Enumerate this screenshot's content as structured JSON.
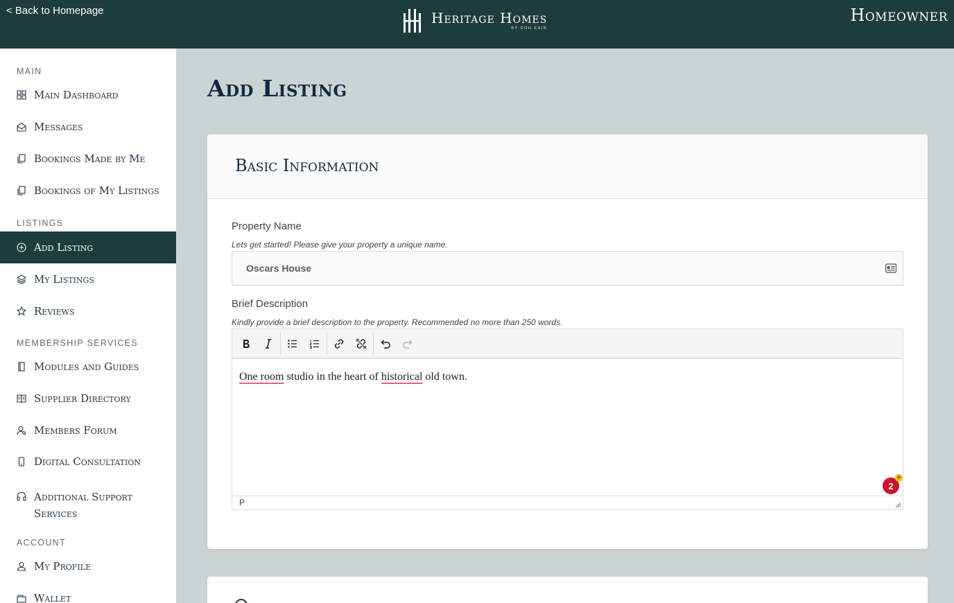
{
  "header": {
    "back_link": "< Back to Homepage",
    "brand_name": "Heritage Homes",
    "brand_sub": "BY DOH EAIN",
    "role": "Homeowner"
  },
  "sidebar": {
    "sections": [
      {
        "label": "MAIN",
        "items": [
          {
            "label": "Main Dashboard",
            "icon": "dashboard-grid-icon"
          },
          {
            "label": "Messages",
            "icon": "envelope-open-icon"
          },
          {
            "label": "Bookings Made by Me",
            "icon": "documents-icon"
          },
          {
            "label": "Bookings of My Listings",
            "icon": "documents-icon"
          }
        ]
      },
      {
        "label": "LISTINGS",
        "items": [
          {
            "label": "Add Listing",
            "icon": "plus-circle-icon",
            "active": true
          },
          {
            "label": "My Listings",
            "icon": "layers-icon"
          },
          {
            "label": "Reviews",
            "icon": "star-icon"
          }
        ]
      },
      {
        "label": "MEMBERSHIP SERVICES",
        "items": [
          {
            "label": "Modules and Guides",
            "icon": "book-icon"
          },
          {
            "label": "Supplier Directory",
            "icon": "open-book-icon"
          },
          {
            "label": "Members Forum",
            "icon": "user-search-icon"
          },
          {
            "label": "Digital Consultation",
            "icon": "phone-icon"
          },
          {
            "label": "Additional Support Services",
            "icon": "headphones-icon"
          }
        ]
      },
      {
        "label": "ACCOUNT",
        "items": [
          {
            "label": "My Profile",
            "icon": "user-icon"
          },
          {
            "label": "Wallet",
            "icon": "wallet-icon"
          }
        ]
      }
    ]
  },
  "main": {
    "page_title": "Add Listing",
    "basic_info": {
      "title": "Basic Information",
      "property_name": {
        "label": "Property Name",
        "hint": "Lets get started! Please give your property a unique name.",
        "value": "Oscars House"
      },
      "brief_description": {
        "label": "Brief Description",
        "hint": "Kindly provide a brief description to the property. Recommended no more than 250 words.",
        "content_parts": [
          "One room",
          " studio in the heart of ",
          "historical",
          " old town."
        ],
        "status_path": "P",
        "badge_count": "2",
        "badge_plus": "+"
      }
    }
  },
  "colors": {
    "header_bg": "#1c3c3e",
    "page_bg": "#c9d4d3",
    "active_nav_bg": "#1c3c3e",
    "badge_red": "#d0132c"
  }
}
